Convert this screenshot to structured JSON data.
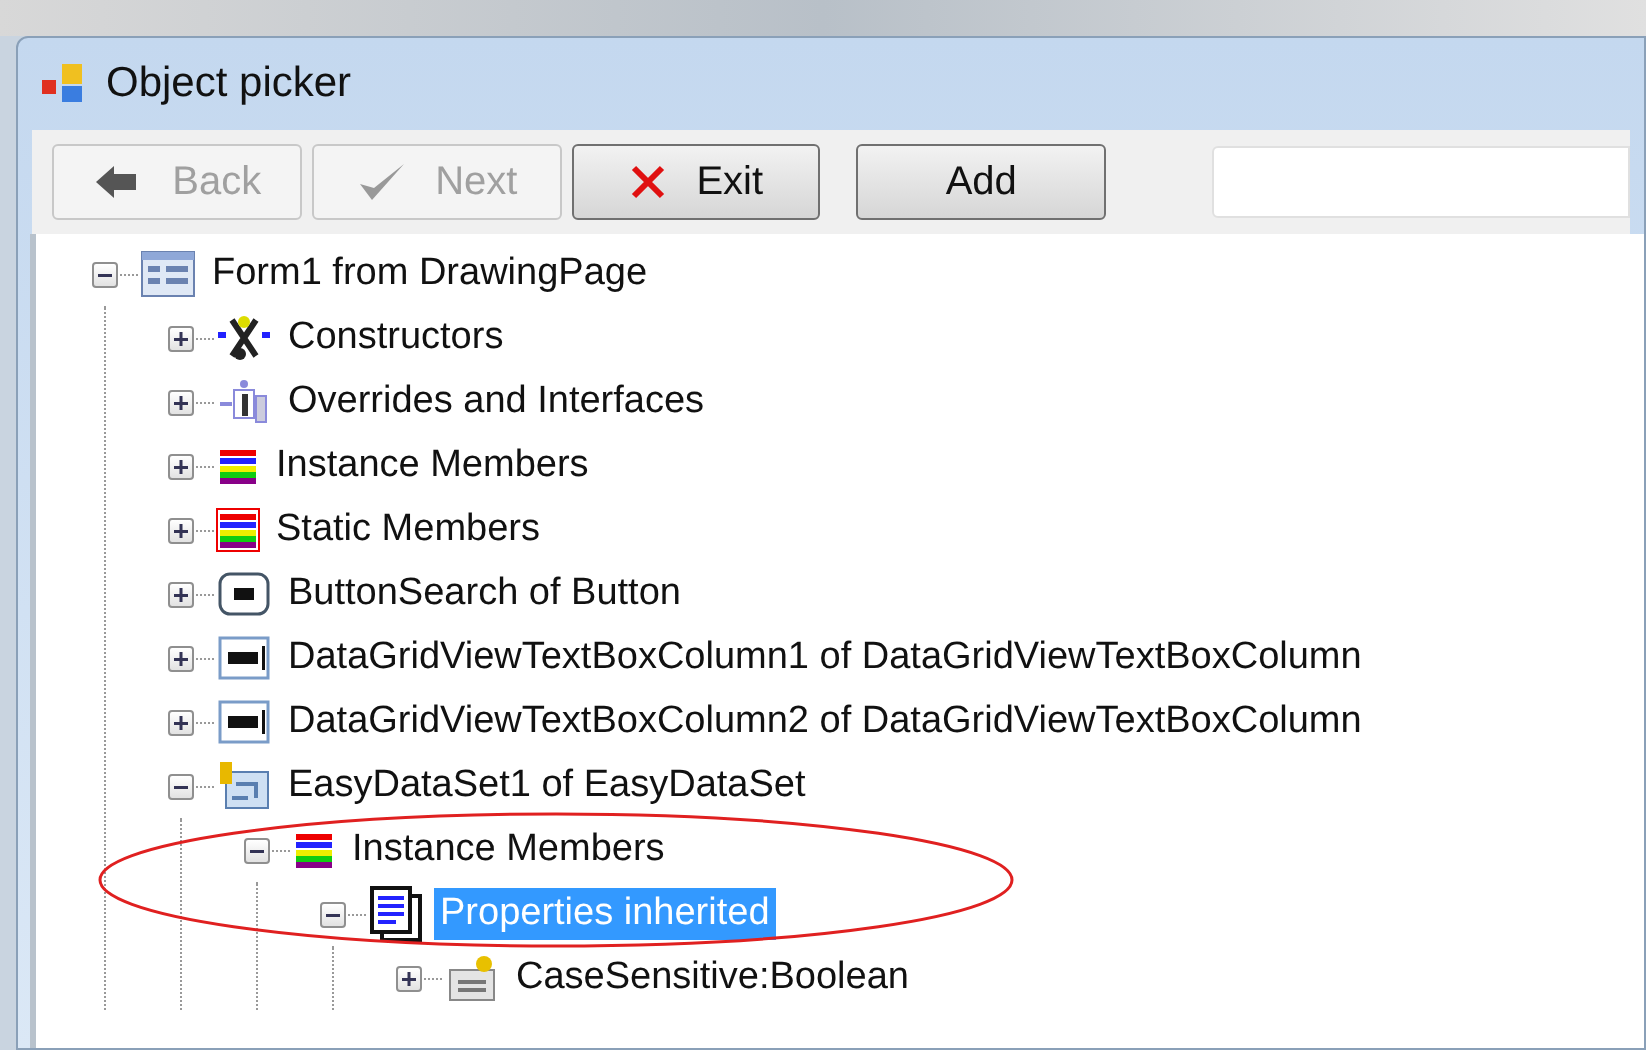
{
  "window": {
    "title": "Object picker"
  },
  "toolbar": {
    "buttons": [
      {
        "label": "Back",
        "kind": "back",
        "disabled": true
      },
      {
        "label": "Next",
        "kind": "next",
        "disabled": true
      },
      {
        "label": "Exit",
        "kind": "exit",
        "disabled": false
      },
      {
        "label": "Add",
        "kind": "plain",
        "disabled": false
      }
    ]
  },
  "tree": [
    {
      "label": "Form1 from DrawingPage",
      "kind": "form",
      "expanded": true,
      "selected": false,
      "children": [
        {
          "label": "Constructors",
          "kind": "constructor",
          "expanded": false,
          "selected": false
        },
        {
          "label": "Overrides and Interfaces",
          "kind": "override",
          "expanded": false,
          "selected": false
        },
        {
          "label": "Instance Members",
          "kind": "members",
          "expanded": false,
          "selected": false
        },
        {
          "label": "Static Members",
          "kind": "static",
          "expanded": false,
          "selected": false
        },
        {
          "label": "ButtonSearch of Button",
          "kind": "button",
          "expanded": false,
          "selected": false
        },
        {
          "label": "DataGridViewTextBoxColumn1 of DataGridViewTextBoxColumn",
          "kind": "textbox",
          "expanded": false,
          "selected": false
        },
        {
          "label": "DataGridViewTextBoxColumn2 of DataGridViewTextBoxColumn",
          "kind": "textbox",
          "expanded": false,
          "selected": false
        },
        {
          "label": "EasyDataSet1 of EasyDataSet",
          "kind": "dataset",
          "expanded": true,
          "selected": false,
          "children": [
            {
              "label": "Instance Members",
              "kind": "members",
              "expanded": true,
              "selected": false,
              "children": [
                {
                  "label": "Properties inherited",
                  "kind": "properties",
                  "expanded": true,
                  "selected": true,
                  "children": [
                    {
                      "label": "CaseSensitive:Boolean",
                      "kind": "property",
                      "expanded": false,
                      "selected": false
                    }
                  ]
                }
              ]
            }
          ]
        }
      ]
    }
  ]
}
